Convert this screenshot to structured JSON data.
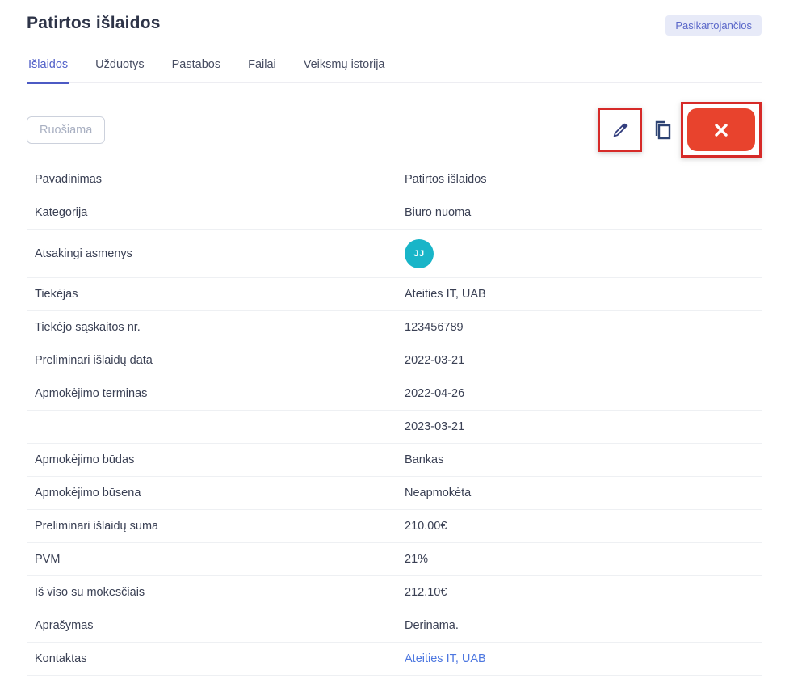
{
  "header": {
    "title": "Patirtos išlaidos",
    "badge": "Pasikartojančios"
  },
  "tabs": [
    {
      "label": "Išlaidos",
      "active": true
    },
    {
      "label": "Užduotys",
      "active": false
    },
    {
      "label": "Pastabos",
      "active": false
    },
    {
      "label": "Failai",
      "active": false
    },
    {
      "label": "Veiksmų istorija",
      "active": false
    }
  ],
  "toolbar": {
    "status_label": "Ruošiama",
    "icons": [
      "pencil-icon",
      "copy-icon",
      "close-icon"
    ]
  },
  "details": {
    "rows": [
      {
        "label": "Pavadinimas",
        "value": "Patirtos išlaidos"
      },
      {
        "label": "Kategorija",
        "value": "Biuro nuoma"
      },
      {
        "label": "Atsakingi asmenys",
        "value": "",
        "avatar_initials": "JJ"
      },
      {
        "label": "Tiekėjas",
        "value": "Ateities IT, UAB"
      },
      {
        "label": "Tiekėjo sąskaitos nr.",
        "value": "123456789"
      },
      {
        "label": "Preliminari išlaidų data",
        "value": "2022-03-21"
      },
      {
        "label": "Apmokėjimo terminas",
        "value": "2022-04-26"
      },
      {
        "label": "",
        "value": "2023-03-21"
      },
      {
        "label": "Apmokėjimo būdas",
        "value": "Bankas"
      },
      {
        "label": "Apmokėjimo būsena",
        "value": "Neapmokėta"
      },
      {
        "label": "Preliminari išlaidų suma",
        "value": "210.00€"
      },
      {
        "label": "PVM",
        "value": "21%"
      },
      {
        "label": "Iš viso su mokesčiais",
        "value": "212.10€"
      },
      {
        "label": "Aprašymas",
        "value": "Derinama."
      },
      {
        "label": "Kontaktas",
        "value": "Ateities IT, UAB",
        "link": true
      }
    ]
  },
  "colors": {
    "active_tab": "#5160c8",
    "badge_bg": "#e7eaf8",
    "badge_text": "#5a67c9",
    "avatar_bg": "#19b5c8",
    "close_button_bg": "#e8432d",
    "annotation_border": "#d62a28",
    "link": "#4d77e0",
    "divider": "#eef0f3"
  }
}
